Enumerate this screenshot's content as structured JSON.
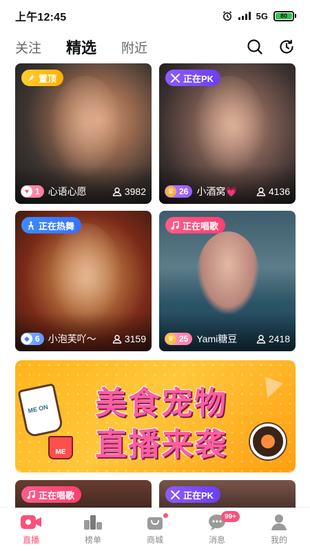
{
  "status_bar": {
    "time": "上午12:45",
    "network": "5G",
    "battery": "80",
    "icons": [
      "alarm-icon",
      "signal-icon",
      "battery-icon"
    ]
  },
  "tabs": [
    {
      "label": "关注",
      "active": false
    },
    {
      "label": "精选",
      "active": true
    },
    {
      "label": "附近",
      "active": false
    }
  ],
  "header_icons": [
    "search-icon",
    "history-icon"
  ],
  "cards": [
    {
      "badge": "置顶",
      "badge_icon": "pin-icon",
      "badge_color": "#ffb100",
      "level": "1",
      "level_icon": "heart-icon",
      "name": "心语心愿",
      "viewers": "3982"
    },
    {
      "badge": "正在PK",
      "badge_icon": "swords-icon",
      "badge_color": "#6a3ff2",
      "level": "26",
      "level_icon": "crown-icon",
      "name": "小酒窝💗",
      "viewers": "4136"
    },
    {
      "badge": "正在热舞",
      "badge_icon": "dance-icon",
      "badge_color": "#3573ff",
      "level": "6",
      "level_icon": "diamond-icon",
      "name": "小泡芙吖～",
      "viewers": "3159"
    },
    {
      "badge": "正在唱歌",
      "badge_icon": "music-note-icon",
      "badge_color": "#ff3f71",
      "level": "25",
      "level_icon": "crown-icon",
      "name": "Yami糖豆",
      "viewers": "2418"
    }
  ],
  "banner": {
    "line1": "美食宠物",
    "line2": "直播来袭"
  },
  "peek_cards": [
    {
      "badge": "正在唱歌",
      "badge_icon": "music-note-icon"
    },
    {
      "badge": "正在PK",
      "badge_icon": "swords-icon"
    }
  ],
  "nav": [
    {
      "label": "直播",
      "icon": "live-icon",
      "active": true
    },
    {
      "label": "榜单",
      "icon": "ranking-icon",
      "active": false
    },
    {
      "label": "商城",
      "icon": "shop-icon",
      "active": false,
      "dot": true
    },
    {
      "label": "消息",
      "icon": "message-icon",
      "active": false,
      "count": "99+"
    },
    {
      "label": "我的",
      "icon": "profile-icon",
      "active": false
    }
  ],
  "colors": {
    "accent": "#ff4f7b",
    "text": "#111111",
    "muted": "#888888"
  }
}
